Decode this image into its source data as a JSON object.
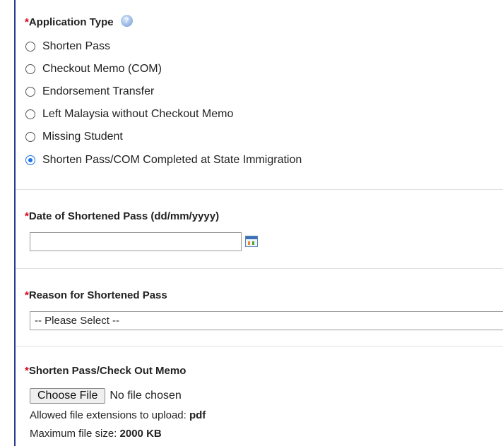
{
  "application_type": {
    "required_mark": "*",
    "label": "Application Type",
    "help_icon": "help-question-icon",
    "options": [
      {
        "label": "Shorten Pass",
        "checked": false
      },
      {
        "label": "Checkout Memo (COM)",
        "checked": false
      },
      {
        "label": "Endorsement Transfer",
        "checked": false
      },
      {
        "label": "Left Malaysia without Checkout Memo",
        "checked": false
      },
      {
        "label": "Missing Student",
        "checked": false
      },
      {
        "label": "Shorten Pass/COM Completed at State Immigration",
        "checked": true
      }
    ]
  },
  "date_field": {
    "required_mark": "*",
    "label": "Date of Shortened Pass (dd/mm/yyyy)",
    "value": "",
    "icon": "calendar-icon"
  },
  "reason_field": {
    "required_mark": "*",
    "label": "Reason for Shortened Pass",
    "selected": "-- Please Select --"
  },
  "upload_field": {
    "required_mark": "*",
    "label": "Shorten Pass/Check Out Memo",
    "button_label": "Choose File",
    "file_status": "No file chosen",
    "extensions_prefix": "Allowed file extensions to upload:",
    "extensions_value": "pdf",
    "max_size_prefix": "Maximum file size:",
    "max_size_value": "2000 KB"
  },
  "colors": {
    "required": "#d9001b",
    "radio_checked": "#1a73e8",
    "frame_border": "#2b3a8c"
  }
}
